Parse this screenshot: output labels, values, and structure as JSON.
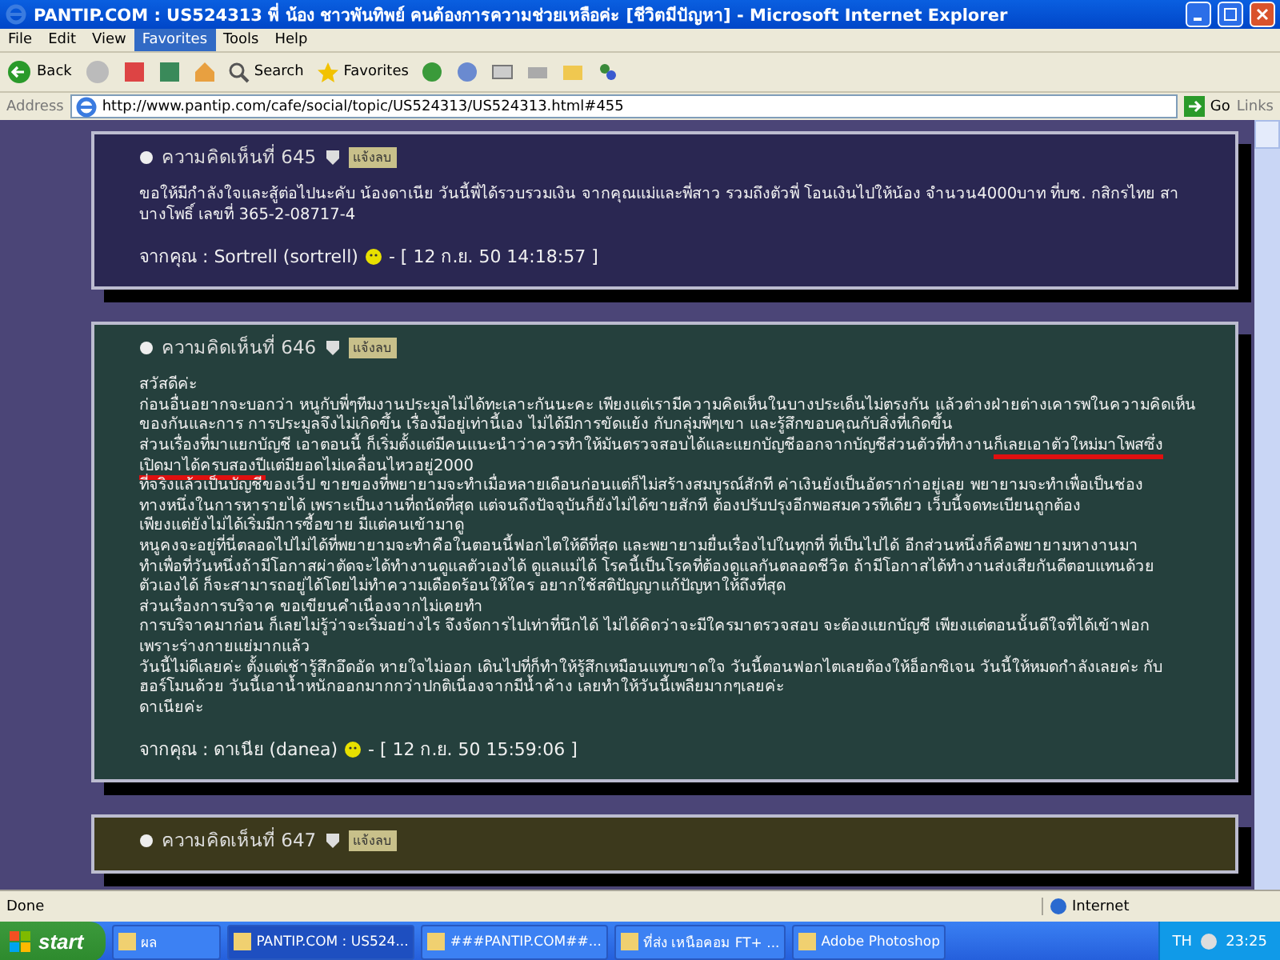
{
  "window": {
    "title": "PANTIP.COM : US524313 พี่ น้อง ชาวพันทิพย์ คนต้องการความช่วยเหลือค่ะ [ชีวิตมีปัญหา] - Microsoft Internet Explorer"
  },
  "menu": [
    {
      "label": "File",
      "selected": false
    },
    {
      "label": "Edit",
      "selected": false
    },
    {
      "label": "View",
      "selected": false
    },
    {
      "label": "Favorites",
      "selected": true
    },
    {
      "label": "Tools",
      "selected": false
    },
    {
      "label": "Help",
      "selected": false
    }
  ],
  "toolbar": {
    "back": "Back",
    "search": "Search",
    "favorites": "Favorites"
  },
  "address": {
    "label": "Address",
    "url": "http://www.pantip.com/cafe/social/topic/US524313/US524313.html#455",
    "go": "Go",
    "links": "Links"
  },
  "comments": [
    {
      "heading": "ความคิดเห็นที่ 645",
      "tag": "แจ้งลบ",
      "color": "#2a2752",
      "lines": [
        [
          {
            "text": "ขอให้มีกำลังใจและสู้ต่อไปนะคับ น้องดาเนีย วันนี้พี่ได้รวบรวมเงิน จากคุณแม่และพี่สาว รวมถึงตัวพี่ โอนเงินไปให้น้อง จำนวน4000บาท ที่บช. กสิกรไทย สา",
            "underlined": false
          }
        ],
        [
          {
            "text": "บางโพธิ์ เลขที่ 365-2-08717-4",
            "underlined": false
          }
        ]
      ],
      "author": "จากคุณ : Sortrell (sortrell)",
      "time": "- [ 12 ก.ย. 50 14:18:57 ]"
    },
    {
      "heading": "ความคิดเห็นที่ 646",
      "tag": "แจ้งลบ",
      "color": "#25403d",
      "lines": [
        [
          {
            "text": "สวัสดีค่ะ",
            "underlined": false
          }
        ],
        [
          {
            "text": "ก่อนอื่นอยากจะบอกว่า หนูกับพี่ๆทีมงานประมูลไม่ได้ทะเลาะกันนะคะ เพียงแต่เรามีความคิดเห็นในบางประเด็นไม่ตรงกัน แล้วต่างฝ่ายต่างเคารพในความคิดเห็น",
            "underlined": false
          }
        ],
        [
          {
            "text": "ของกันและการ การประมูลจึงไม่เกิดขึ้น เรื่องมีอยู่เท่านี้เอง ไม่ได้มีการขัดแย้ง กับกลุ่มพี่ๆเขา และรู้สึกขอบคุณกับสิ่งที่เกิดขึ้น",
            "underlined": false
          }
        ],
        [
          {
            "text": "ส่วนเรื่องที่มาแยกบัญชี เอาตอนนี้ ก็เริ่มตั้งแต่มีคนแนะนำว่าควรทำให้มันตรวจสอบได้และแยกบัญชีออกจากบัญชีส่วนตัวที่ทำงาน",
            "underlined": false
          },
          {
            "text": "ก็เลยเอาตัวใหม่มาโพสซึ่ง",
            "underlined": true
          }
        ],
        [
          {
            "text": "เปิดมาได้ครบสองปี",
            "underlined": true
          },
          {
            "text": "แต่มียอดไม่เคลื่อนไหวอยู่2000",
            "underlined": false
          }
        ],
        [
          {
            "text": "ที่จริงแล้วเป็นบัญชีของเว็ป ขายของที่พยายามจะทำเมื่อหลายเดือนก่อนแต่ก็ไม่สร้างสมบูรณ์สักที ค่าเงินยังเป็นอัตราก่าอยู่เลย พยายามจะทำเพื่อเป็นช่อง",
            "underlined": false
          }
        ],
        [
          {
            "text": "ทางหนึ่งในการหารายได้ เพราะเป็นงานที่ถนัดที่สุด แต่จนถึงปัจจุบันก็ยังไม่ได้ขายสักที ต้องปรับปรุงอีกพอสมควรทีเดียว เว็บนี้จดทะเบียนถูกต้อง",
            "underlined": false
          }
        ],
        [
          {
            "text": "เพียงแต่ยังไม่ได้เริ่มมีการซื้อขาย มีแต่คนเข้ามาดู",
            "underlined": false
          }
        ],
        [
          {
            "text": "หนูคงจะอยู่ที่นี่ตลอดไปไม่ได้ที่พยายามจะทำคือในตอนนี้ฟอกไตให้ดีที่สุด และพยายามยื่นเรื่องไปในทุกที่ ที่เป็นไปได้ อีกส่วนหนึ่งก็คือพยายามหางานมา",
            "underlined": false
          }
        ],
        [
          {
            "text": "ทำเพื่อที่วันหนึ่งถ้ามีโอกาสผ่าตัดจะได้ทำงานดูแลตัวเองได้ ดูแลแม่ได้ โรคนี้เป็นโรคที่ต้องดูแลกันตลอดชีวิต ถ้ามีโอกาสได้ทำงานส่งเสียกันดีตอบแทนด้วย",
            "underlined": false
          }
        ],
        [
          {
            "text": "ตัวเองได้ ก็จะสามารถอยู่ได้โดยไม่ทำความเดือดร้อนให้ใคร อยากใช้สติปัญญาแก้ปัญหาให้ถึงที่สุด",
            "underlined": false
          }
        ],
        [
          {
            "text": "ส่วนเรื่องการบริจาค ขอเขียนคำเนื่องจากไม่เคยทำ",
            "underlined": false
          }
        ],
        [
          {
            "text": "การบริจาคมาก่อน ก็เลยไม่รู้ว่าจะเริ่มอย่างไร จึงจัดการไปเท่าที่นึกได้ ไม่ได้คิดว่าจะมีใครมาตรวจสอบ จะต้องแยกบัญชี เพียงแต่ตอนนั้นดีใจที่ได้เข้าฟอก",
            "underlined": false
          }
        ],
        [
          {
            "text": "เพราะร่างกายแย่มากแล้ว",
            "underlined": false
          }
        ],
        [
          {
            "text": "วันนี้ไม่ดีเลยค่ะ ตั้งแต่เช้ารู้สึกอึดอัด หายใจไม่ออก เดินไปที่ก็ทำให้รู้สึกเหมือนแทบขาดใจ วันนี้ตอนฟอกไตเลยต้องให้อ็อกซิเจน วันนี้ให้หมดกำลังเลยค่ะ กับ",
            "underlined": false
          }
        ],
        [
          {
            "text": "ฮอร์โมนด้วย วันนี้เอาน้ำหนักออกมากกว่าปกติเนื่องจากมีน้ำค้าง เลยทำให้วันนี้เพลียมากๆเลยค่ะ",
            "underlined": false
          }
        ],
        [
          {
            "text": "ดาเนียค่ะ",
            "underlined": false
          }
        ]
      ],
      "author": "จากคุณ : ดาเนีย (danea)",
      "time": "- [ 12 ก.ย. 50 15:59:06 ]"
    },
    {
      "heading": "ความคิดเห็นที่ 647",
      "tag": "แจ้งลบ",
      "color": "#3c391c"
    }
  ],
  "status_bar": {
    "text": "Done",
    "zone": "Internet"
  },
  "taskbar": {
    "start": "start",
    "items": [
      {
        "label": "ผล",
        "selected": false
      },
      {
        "label": "PANTIP.COM : US524...",
        "selected": true
      },
      {
        "label": "###PANTIP.COM##...",
        "selected": false
      },
      {
        "label": "ที่ส่ง เหนือคอม FT+ ...",
        "selected": false
      },
      {
        "label": "Adobe Photoshop",
        "selected": false
      }
    ],
    "lang": "TH",
    "clock": "23:25"
  }
}
